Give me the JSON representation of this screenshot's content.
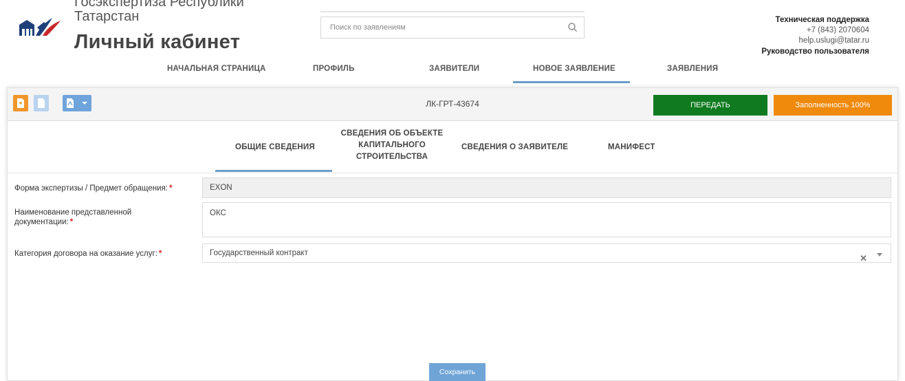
{
  "header": {
    "org_line1": "Госэкспертиза Республики",
    "org_line2": "Татарстан",
    "cabinet_title": "Личный кабинет",
    "search_placeholder": "Поиск по заявлениям",
    "support": {
      "title": "Техническая поддержка",
      "phone": "+7 (843) 2070604",
      "email": "help.uslugi@tatar.ru",
      "manual": "Руководство пользователя"
    }
  },
  "nav": {
    "items": [
      {
        "label": "НАЧАЛЬНАЯ СТРАНИЦА"
      },
      {
        "label": "ПРОФИЛЬ"
      },
      {
        "label": "ЗАЯВИТЕЛИ"
      },
      {
        "label": "НОВОЕ ЗАЯВЛЕНИЕ"
      },
      {
        "label": "ЗАЯВЛЕНИЯ"
      }
    ],
    "active": "НОВОЕ ЗАЯВЛЕНИЕ"
  },
  "toolbar": {
    "application_id": "ЛК-ГРТ-43674",
    "send_label": "ПЕРЕДАТЬ",
    "fill_label": "Заполненность 100%"
  },
  "tabs": {
    "items": [
      {
        "label": "ОБЩИЕ СВЕДЕНИЯ"
      },
      {
        "label_lines": [
          "СВЕДЕНИЯ ОБ ОБЪЕКТЕ",
          "КАПИТАЛЬНОГО",
          "СТРОИТЕЛЬСТВА"
        ]
      },
      {
        "label": "СВЕДЕНИЯ О ЗАЯВИТЕЛЕ"
      },
      {
        "label": "МАНИФЕСТ"
      }
    ],
    "active": "ОБЩИЕ СВЕДЕНИЯ"
  },
  "form": {
    "expertise_form": {
      "label": "Форма экспертизы / Предмет обращения:",
      "value": "EXON"
    },
    "doc_name": {
      "label_lines": [
        "Наименование представленной",
        "документации:"
      ],
      "value": "ОКС"
    },
    "contract_category": {
      "label": "Категория договора на оказание услуг:",
      "value": "Государственный контракт"
    },
    "required_mark": "*"
  },
  "save_label": "Сохранить",
  "colors": {
    "accent_blue": "#6a9cc9",
    "send_green": "#0f7a1f",
    "fill_orange": "#ef8a0d",
    "required_red": "#d22"
  }
}
